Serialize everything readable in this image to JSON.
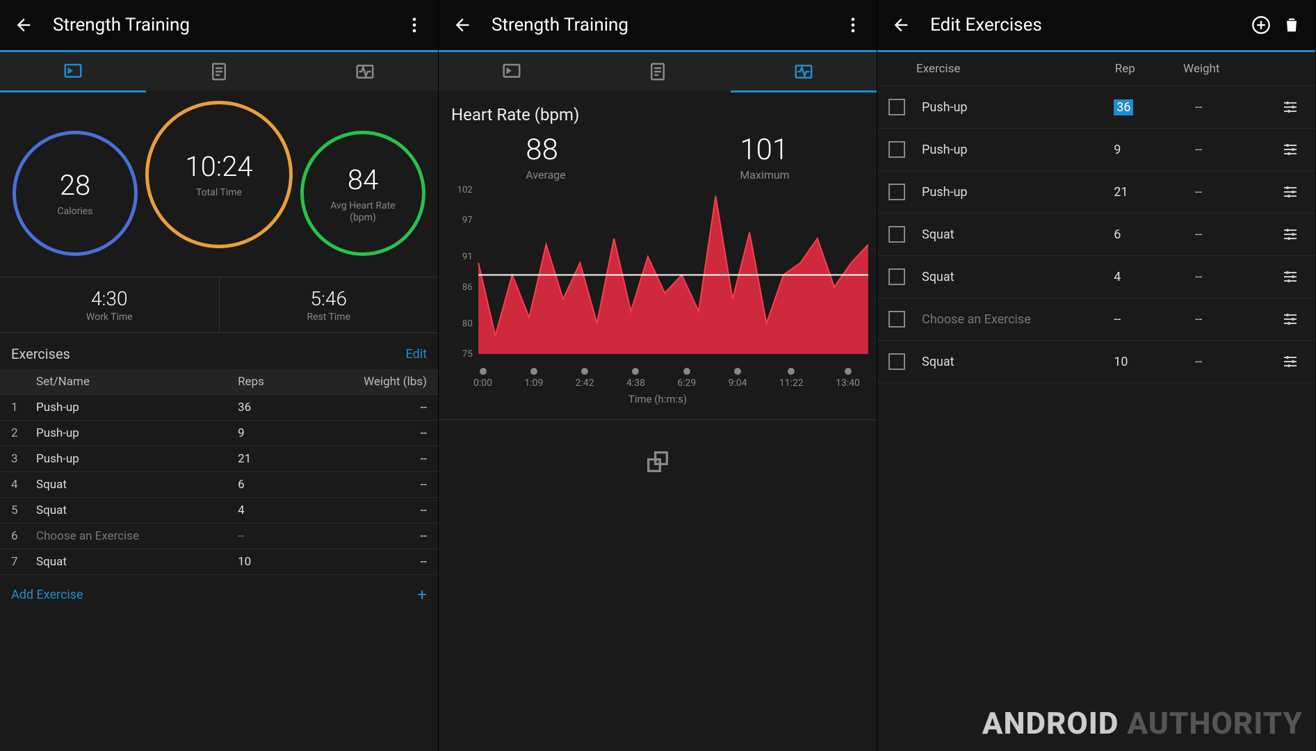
{
  "panel1": {
    "title": "Strength Training",
    "active_tab": 0,
    "rings": {
      "center": {
        "value": "10:24",
        "label": "Total Time"
      },
      "left": {
        "value": "28",
        "label": "Calories"
      },
      "right": {
        "value": "84",
        "label": "Avg Heart Rate\n(bpm)"
      }
    },
    "splits": {
      "work": {
        "value": "4:30",
        "label": "Work Time"
      },
      "rest": {
        "value": "5:46",
        "label": "Rest Time"
      }
    },
    "exercises_header": "Exercises",
    "edit_link": "Edit",
    "thead": {
      "set": "Set/Name",
      "reps": "Reps",
      "weight": "Weight (lbs)"
    },
    "rows": [
      {
        "i": "1",
        "name": "Push-up",
        "reps": "36",
        "wt": "--"
      },
      {
        "i": "2",
        "name": "Push-up",
        "reps": "9",
        "wt": "--"
      },
      {
        "i": "3",
        "name": "Push-up",
        "reps": "21",
        "wt": "--"
      },
      {
        "i": "4",
        "name": "Squat",
        "reps": "6",
        "wt": "--"
      },
      {
        "i": "5",
        "name": "Squat",
        "reps": "4",
        "wt": "--"
      },
      {
        "i": "6",
        "name": "Choose an Exercise",
        "reps": "--",
        "wt": "--",
        "muted": true
      },
      {
        "i": "7",
        "name": "Squat",
        "reps": "10",
        "wt": "--"
      }
    ],
    "add_label": "Add Exercise"
  },
  "panel2": {
    "title": "Strength Training",
    "active_tab": 2,
    "hr_title": "Heart Rate (bpm)",
    "avg": {
      "v": "88",
      "l": "Average"
    },
    "max": {
      "v": "101",
      "l": "Maximum"
    },
    "xaxis": "Time (h:m:s)",
    "yticks": [
      "102",
      "97",
      "91",
      "86",
      "80",
      "75"
    ]
  },
  "panel3": {
    "title": "Edit Exercises",
    "head": {
      "ex": "Exercise",
      "rep": "Rep",
      "wt": "Weight"
    },
    "rows": [
      {
        "name": "Push-up",
        "rep": "36",
        "wt": "--",
        "hl": true
      },
      {
        "name": "Push-up",
        "rep": "9",
        "wt": "--"
      },
      {
        "name": "Push-up",
        "rep": "21",
        "wt": "--"
      },
      {
        "name": "Squat",
        "rep": "6",
        "wt": "--"
      },
      {
        "name": "Squat",
        "rep": "4",
        "wt": "--"
      },
      {
        "name": "Choose an Exercise",
        "rep": "--",
        "wt": "--",
        "muted": true
      },
      {
        "name": "Squat",
        "rep": "10",
        "wt": "--"
      }
    ]
  },
  "watermark": {
    "a": "ANDROID ",
    "b": "AUTHORITY"
  },
  "chart_data": {
    "type": "area",
    "title": "Heart Rate (bpm)",
    "xlabel": "Time (h:m:s)",
    "ylabel": "bpm",
    "ylim": [
      75,
      102
    ],
    "avg_line": 88,
    "x": [
      "0:00",
      "1:09",
      "2:42",
      "4:38",
      "6:29",
      "9:04",
      "11:22",
      "13:40"
    ],
    "values": [
      90,
      78,
      88,
      81,
      93,
      84,
      90,
      80,
      94,
      82,
      91,
      85,
      88,
      82,
      101,
      84,
      95,
      80,
      88,
      90,
      94,
      86,
      90,
      93
    ]
  }
}
